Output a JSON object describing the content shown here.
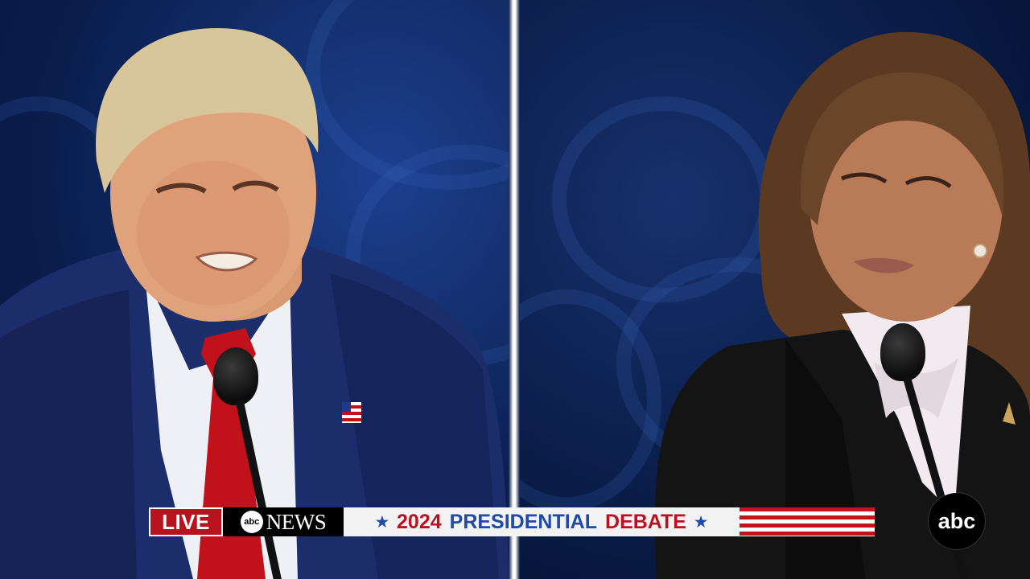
{
  "ticker": {
    "live_label": "LIVE",
    "network_label": "NEWS",
    "network_mark": "abc",
    "year": "2024",
    "word_presidential": "PRESIDENTIAL",
    "word_debate": "DEBATE",
    "star_glyph": "★"
  },
  "corner_logo": {
    "text": "abc"
  },
  "colors": {
    "live_red": "#b8121f",
    "title_blue": "#1f4aa8",
    "stage_blue": "#0a1e4f"
  }
}
